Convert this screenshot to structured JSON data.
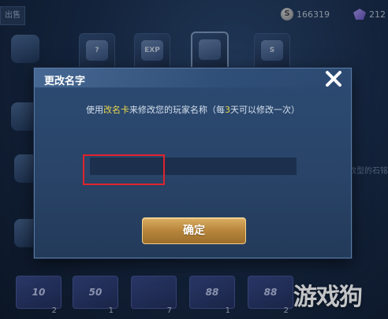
{
  "background": {
    "top_tab_label": "出售",
    "currency": {
      "coins": "166319",
      "coin_glyph": "S",
      "gems": "212"
    },
    "shop_items": [
      {
        "label": "?"
      },
      {
        "label": "EXP"
      },
      {
        "label": "S"
      }
    ],
    "side_text": "改型的石铭",
    "bottom_tickets": [
      {
        "label": "10",
        "count": "2"
      },
      {
        "label": "50",
        "count": "1"
      },
      {
        "label": "",
        "count": "7"
      },
      {
        "label": "88",
        "count": "1"
      },
      {
        "label": "88",
        "count": "2"
      }
    ],
    "watermark": "游戏狗"
  },
  "dialog": {
    "title": "更改名字",
    "instruction": {
      "before": "使用",
      "item_name": "改名卡",
      "middle": "来修改您的玩家名称（每",
      "days": "3",
      "after": "天可以修改一次）"
    },
    "name_input": {
      "value": "",
      "placeholder": ""
    },
    "confirm_label": "确定"
  },
  "colors": {
    "highlight_text": "#e9d94d",
    "confirm_button": "#c4944a",
    "annotation_box": "#e0232b",
    "dialog_bg": "#294468"
  },
  "icons": [
    "close-icon",
    "coin-icon",
    "gem-icon"
  ]
}
